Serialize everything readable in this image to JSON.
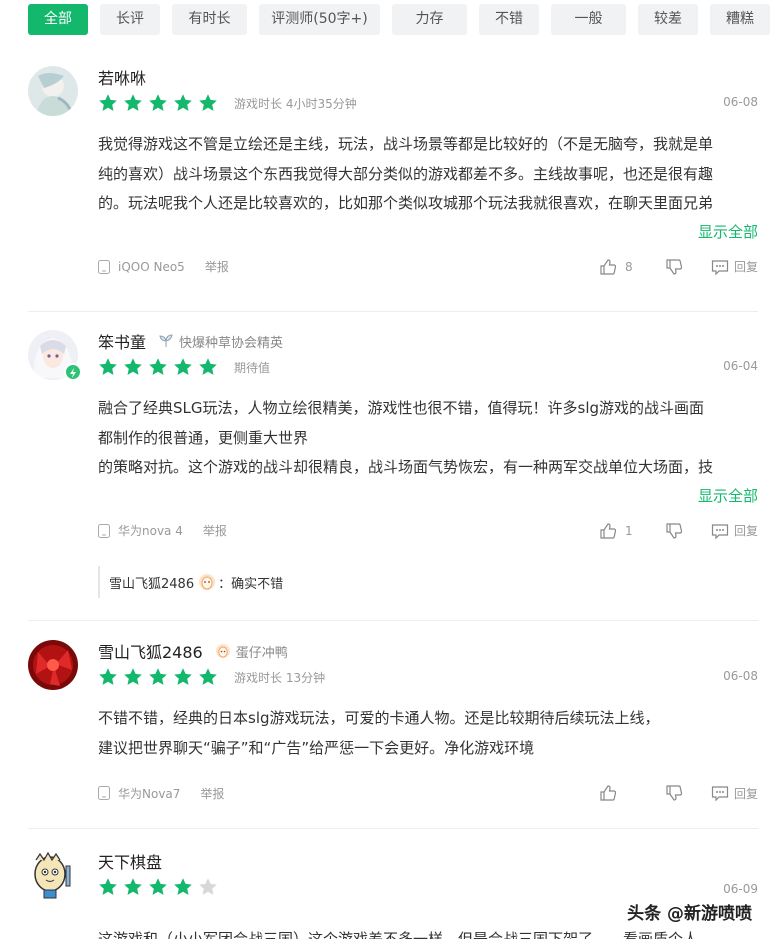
{
  "filters": [
    "全部",
    "长评",
    "有时长",
    "评测师(50字+)",
    "力存",
    "不错",
    "一般",
    "较差",
    "糟糕"
  ],
  "colors": {
    "accent": "#14b86d",
    "star_on": "#14b86d",
    "star_off": "#d8d8d8"
  },
  "reviews": [
    {
      "name": "若咻咻",
      "badge": "",
      "rating": 5,
      "meta": "游戏时长 4小时35分钟",
      "date": "06-08",
      "lines": [
        "我觉得游戏这不管是立绘还是主线，玩法，战斗场景等都是比较好的（不是无脑夸，我就是单",
        "纯的喜欢）战斗场景这个东西我觉得大部分类似的游戏都差不多。主线故事呢，也还是很有趣",
        "的。玩法呢我个人还是比较喜欢的，比如那个类似攻城那个玩法我就很喜欢，在聊天里面兄弟"
      ],
      "more": "显示全部",
      "device": "iQOO Neo5",
      "report": "举报",
      "likes": "8",
      "reply": "回复"
    },
    {
      "name": "笨书童",
      "badge": "快爆种草协会精英",
      "rating": 5,
      "meta": "期待值",
      "date": "06-04",
      "lines": [
        "融合了经典SLG玩法，人物立绘很精美，游戏性也很不错，值得玩！许多slg游戏的战斗画面",
        "都制作的很普通，更侧重大世界",
        "的策略对抗。这个游戏的战斗却很精良，战斗场面气势恢宏，有一种两军交战单位大场面，技"
      ],
      "more": "显示全部",
      "device": "华为nova 4",
      "report": "举报",
      "likes": "1",
      "reply": "回复",
      "sub_reply": {
        "author": "雪山飞狐2486",
        "text": "：确实不错"
      }
    },
    {
      "name": "雪山飞狐2486",
      "badge": "蛋仔冲鸭",
      "rating": 5,
      "meta": "游戏时长 13分钟",
      "date": "06-08",
      "lines": [
        "不错不错，经典的日本slg游戏玩法，可爱的卡通人物。还是比较期待后续玩法上线，",
        "建议把世界聊天“骗子”和“广告”给严惩一下会更好。净化游戏环境"
      ],
      "device": "华为Nova7",
      "report": "举报",
      "likes": "",
      "reply": "回复"
    },
    {
      "name": "天下棋盘",
      "rating": 4,
      "date": "06-09",
      "lines": [
        "这游戏和（小小军团合战三国）这个游戏差不多一样，但是合战三国下架了…，看画质个人"
      ]
    }
  ],
  "watermark": "头条 @新游喷喷"
}
